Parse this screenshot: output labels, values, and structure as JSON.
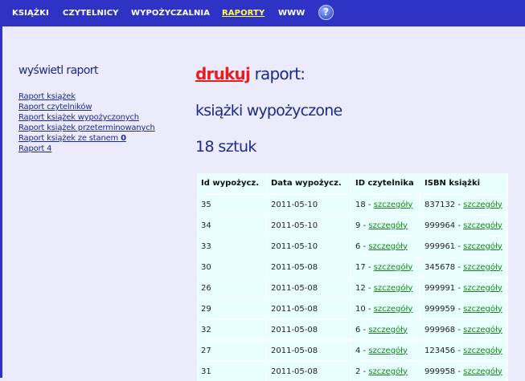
{
  "nav": {
    "items": [
      {
        "label": "KSIĄŻKI"
      },
      {
        "label": "CZYTELNICY"
      },
      {
        "label": "WYPOŻYCZALNIA"
      },
      {
        "label": "RAPORTY"
      },
      {
        "label": "WWW"
      }
    ],
    "help_label": "?"
  },
  "sidebar": {
    "title": "wyświetl raport",
    "links": [
      {
        "label": "Raport książek"
      },
      {
        "label": "Raport czytelników"
      },
      {
        "label": "Raport książek wypożyczonych"
      },
      {
        "label": "Raport książek przeterminowanych"
      },
      {
        "label": "Raport książek ze stanem ",
        "bold": "0"
      },
      {
        "label": "Raport 4"
      }
    ]
  },
  "main": {
    "print_label": "drukuj",
    "headline_rest": " raport:",
    "subtitle": "książki wypożyczone",
    "count": "18 sztuk"
  },
  "table": {
    "headers": [
      "Id wypożycz.",
      "Data wypożycz.",
      "ID czytelnika",
      "ISBN książki"
    ],
    "details_label": "szczegóły",
    "rows": [
      {
        "id": "35",
        "date": "2011-05-10",
        "reader": "18",
        "isbn": "837132"
      },
      {
        "id": "34",
        "date": "2011-05-10",
        "reader": "9",
        "isbn": "999964"
      },
      {
        "id": "33",
        "date": "2011-05-10",
        "reader": "6",
        "isbn": "999961"
      },
      {
        "id": "30",
        "date": "2011-05-08",
        "reader": "17",
        "isbn": "345678"
      },
      {
        "id": "26",
        "date": "2011-05-08",
        "reader": "12",
        "isbn": "999991"
      },
      {
        "id": "29",
        "date": "2011-05-08",
        "reader": "10",
        "isbn": "999959"
      },
      {
        "id": "32",
        "date": "2011-05-08",
        "reader": "6",
        "isbn": "999968"
      },
      {
        "id": "27",
        "date": "2011-05-08",
        "reader": "4",
        "isbn": "123456"
      },
      {
        "id": "31",
        "date": "2011-05-08",
        "reader": "2",
        "isbn": "999958"
      }
    ]
  },
  "colors": {
    "nav_bar": "#2e33c6",
    "page_bg": "#ebebfb",
    "active_nav": "#ffff44",
    "text_blue": "#1b2a8a",
    "print_red": "#e51e1e",
    "link_green": "#0f8a0f",
    "table_cell": "#e9ffff"
  }
}
